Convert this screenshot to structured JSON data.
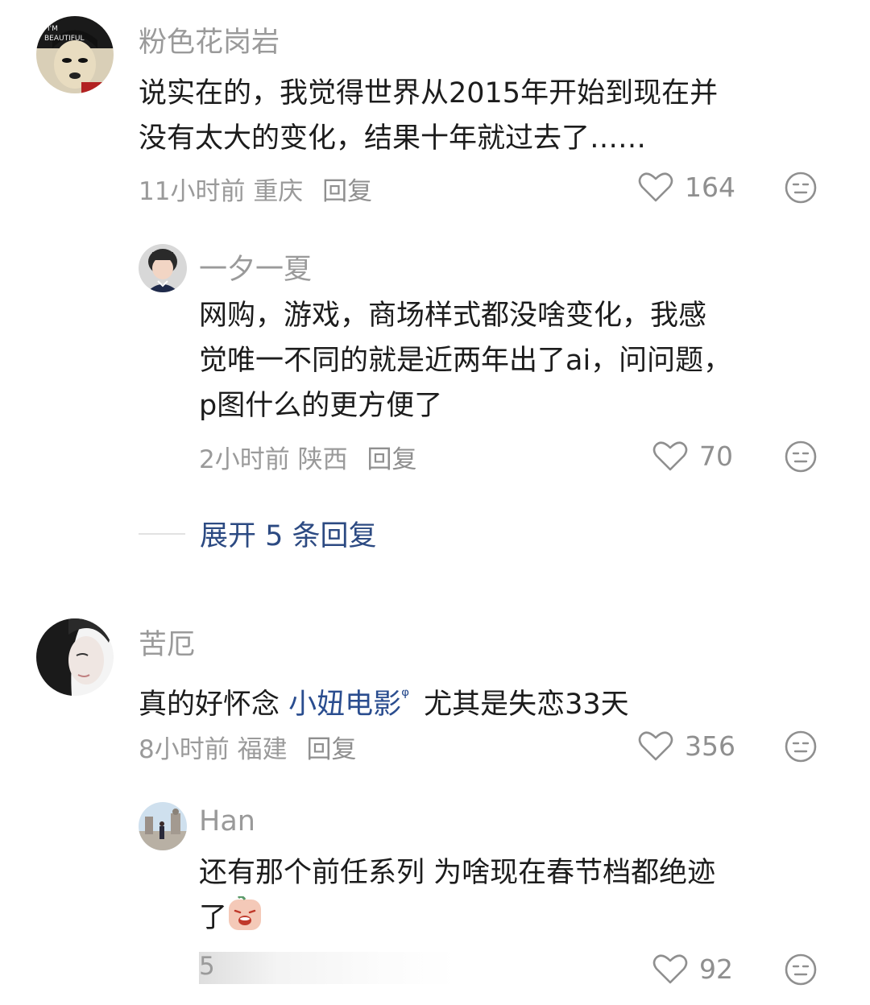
{
  "comments": [
    {
      "user": "粉色花岗岩",
      "text_lines": [
        "说实在的，我觉得世界从2015年开始到现在并",
        "没有太大的变化，结果十年就过去了……"
      ],
      "time": "11小时前",
      "location": "重庆",
      "reply": "回复",
      "likes": "164",
      "replies": [
        {
          "user": "一夕一夏",
          "text_lines": [
            "网购，游戏，商场样式都没啥变化，我感",
            "觉唯一不同的就是近两年出了ai，问问题，",
            "p图什么的更方便了"
          ],
          "time": "2小时前",
          "location": "陕西",
          "reply": "回复",
          "likes": "70"
        }
      ],
      "expand_label": "展开 5 条回复"
    },
    {
      "user": "苦厄",
      "text_prefix": "真的好怀念 ",
      "link_text": "小妞电影",
      "link_mark": "ᵠ",
      "text_suffix": "尤其是失恋33天",
      "time": "8小时前",
      "location": "福建",
      "reply": "回复",
      "likes": "356",
      "replies": [
        {
          "user": "Han",
          "text_lines": [
            "还有那个前任系列 为啥现在春节档都绝迹",
            "了"
          ],
          "time_partial": "5",
          "likes": "92"
        }
      ]
    }
  ],
  "icons": {
    "like": "heart-outline-icon",
    "dislike": "meh-face-icon",
    "sticker": "crying-face-emoji"
  },
  "colors": {
    "text": "#1c1c1c",
    "meta": "#9a9a9a",
    "link": "#2a4d8f",
    "expand": "#2c4a82"
  }
}
